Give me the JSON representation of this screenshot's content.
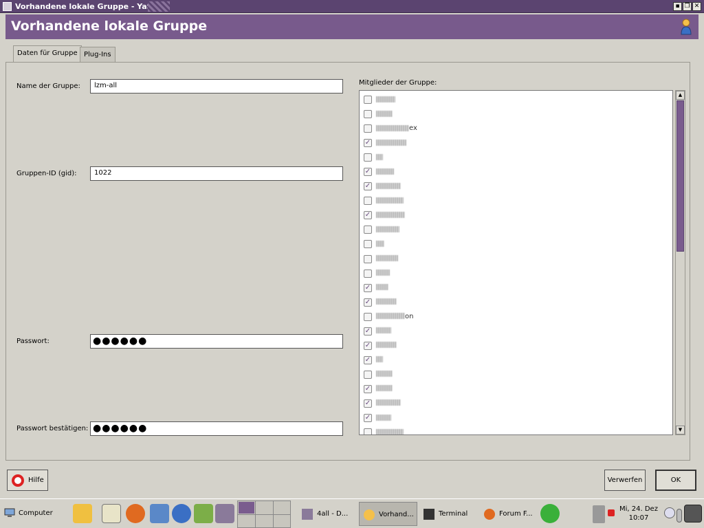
{
  "window": {
    "title": "Vorhandene lokale Gruppe - YaST",
    "minimize_label": "▪",
    "maximize_label": "❐",
    "close_label": "✕"
  },
  "header": {
    "title": "Vorhandene lokale Gruppe",
    "icon": "user-icon"
  },
  "tabs": [
    {
      "label": "Daten für Gruppe",
      "active": true
    },
    {
      "label": "Plug-Ins",
      "active": false
    }
  ],
  "form": {
    "group_name_label": "Name der Gruppe:",
    "group_name_value": "lzm-all",
    "group_id_label": "Gruppen-ID (gid):",
    "group_id_value": "1022",
    "password_label": "Passwort:",
    "password_value": "●●●●●●",
    "password_confirm_label": "Passwort bestätigen:",
    "password_confirm_value": "●●●●●●"
  },
  "members": {
    "label": "Mitglieder der Gruppe:",
    "items": [
      {
        "suffix": "",
        "checked": false
      },
      {
        "suffix": "",
        "checked": false
      },
      {
        "suffix": "ex",
        "checked": false
      },
      {
        "suffix": "",
        "checked": true
      },
      {
        "suffix": "",
        "checked": false
      },
      {
        "suffix": "",
        "checked": true
      },
      {
        "suffix": "",
        "checked": true
      },
      {
        "suffix": "",
        "checked": false
      },
      {
        "suffix": "",
        "checked": true
      },
      {
        "suffix": "",
        "checked": false
      },
      {
        "suffix": "",
        "checked": false
      },
      {
        "suffix": "",
        "checked": false
      },
      {
        "suffix": "",
        "checked": false
      },
      {
        "suffix": "",
        "checked": true
      },
      {
        "suffix": "",
        "checked": true
      },
      {
        "suffix": "on",
        "checked": false
      },
      {
        "suffix": "",
        "checked": true
      },
      {
        "suffix": "",
        "checked": true
      },
      {
        "suffix": "",
        "checked": true
      },
      {
        "suffix": "",
        "checked": false
      },
      {
        "suffix": "",
        "checked": true
      },
      {
        "suffix": "",
        "checked": true
      },
      {
        "suffix": "",
        "checked": true
      },
      {
        "suffix": "",
        "checked": false
      }
    ],
    "check_glyph": "✓"
  },
  "buttons": {
    "help": "Hilfe",
    "discard": "Verwerfen",
    "ok": "OK"
  },
  "taskbar": {
    "computer_label": "Computer",
    "tasks": [
      {
        "label": "4all - D...",
        "active": false
      },
      {
        "label": "Vorhand...",
        "active": true
      },
      {
        "label": "Terminal",
        "active": false
      },
      {
        "label": "Forum F...",
        "active": false
      }
    ],
    "clock_date": "Mi, 24. Dez",
    "clock_time": "10:07"
  }
}
